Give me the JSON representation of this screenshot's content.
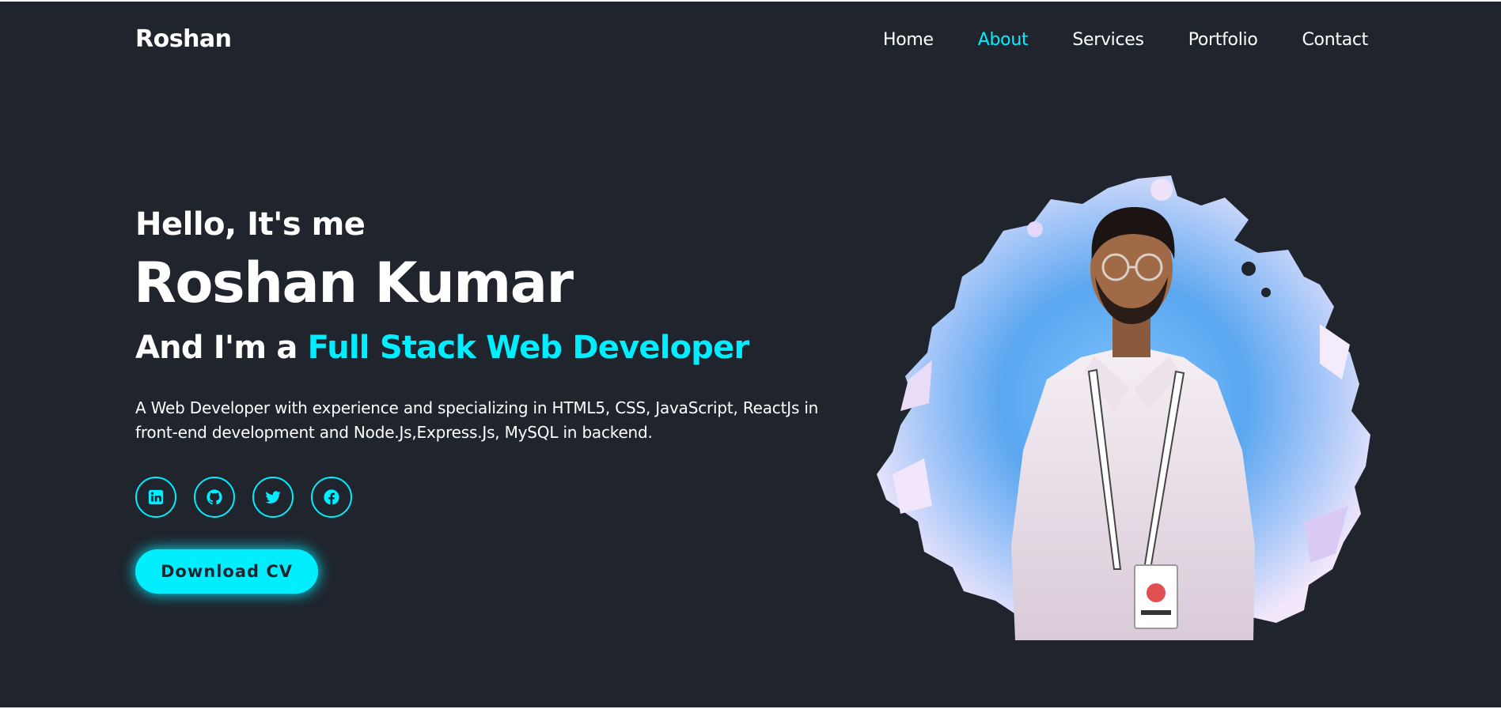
{
  "header": {
    "logo": "Roshan",
    "nav": [
      "Home",
      "About",
      "Services",
      "Portfolio",
      "Contact"
    ],
    "active_item": "About"
  },
  "hero": {
    "greeting": "Hello, It's me",
    "name": "Roshan Kumar",
    "role_prefix": "And I'm a ",
    "role_highlight": "Full Stack Web Developer",
    "description_line1": "A Web Developer with experience and specializing in HTML5, CSS, JavaScript, ReactJs in",
    "description_line2": "front-end development and Node.Js,Express.Js, MySQL in backend.",
    "social_icons": [
      "linkedin-icon",
      "github-icon",
      "twitter-icon",
      "facebook-icon"
    ],
    "cta_label": "Download CV"
  },
  "colors": {
    "background": "#1f242d",
    "accent": "#00eeff",
    "text": "#ffffff"
  }
}
